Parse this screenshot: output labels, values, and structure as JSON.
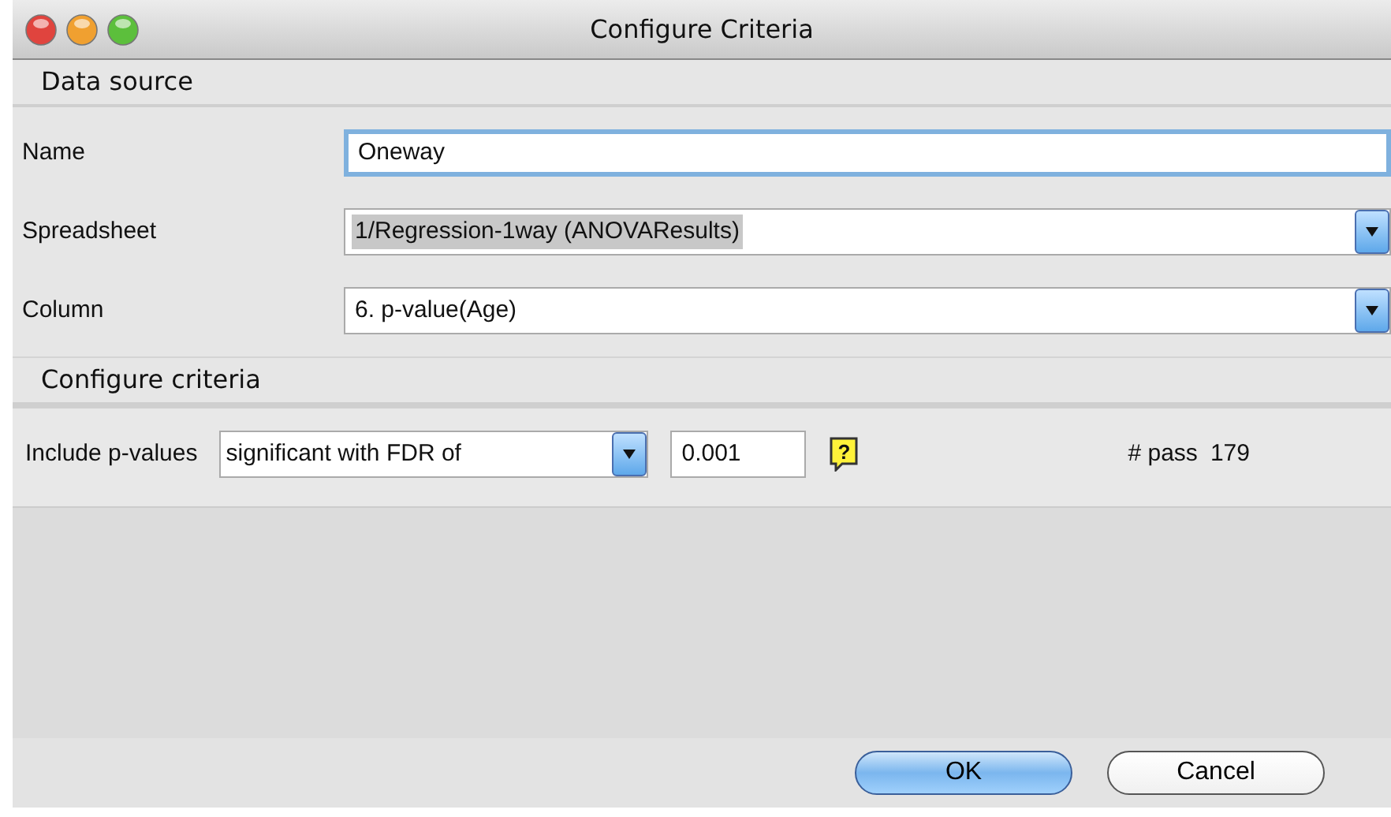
{
  "window": {
    "title": "Configure Criteria"
  },
  "data_source": {
    "heading": "Data source",
    "fields": [
      {
        "label": "Name",
        "kind": "text",
        "value": "Oneway",
        "focused": true,
        "highlighted": false
      },
      {
        "label": "Spreadsheet",
        "kind": "dropdown",
        "value": "1/Regression-1way (ANOVAResults)",
        "focused": false,
        "highlighted": true
      },
      {
        "label": "Column",
        "kind": "dropdown",
        "value": "6. p-value(Age)",
        "focused": false,
        "highlighted": false
      }
    ]
  },
  "criteria": {
    "heading": "Configure criteria",
    "label": "Include p-values",
    "mode": "significant with FDR of",
    "threshold": "0.001",
    "help": "?",
    "pass_label": "# pass",
    "pass_count": "179"
  },
  "buttons": [
    {
      "label": "OK",
      "default": true
    },
    {
      "label": "Cancel",
      "default": false
    }
  ]
}
